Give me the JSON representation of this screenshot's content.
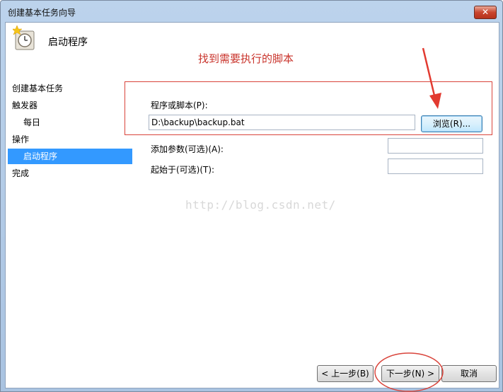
{
  "window": {
    "title": "创建基本任务向导",
    "close_label": "✕"
  },
  "header": {
    "title": "启动程序"
  },
  "annotation": {
    "text": "找到需要执行的脚本"
  },
  "sidebar": {
    "steps": [
      {
        "label": "创建基本任务"
      },
      {
        "label": "触发器"
      },
      {
        "label": "每日"
      },
      {
        "label": "操作"
      },
      {
        "label": "启动程序"
      },
      {
        "label": "完成"
      }
    ]
  },
  "form": {
    "program_label": "程序或脚本(P):",
    "program_value": "D:\\backup\\backup.bat",
    "browse_label": "浏览(R)...",
    "args_label": "添加参数(可选)(A):",
    "args_value": "",
    "startin_label": "起始于(可选)(T):",
    "startin_value": ""
  },
  "watermark": {
    "text": "http://blog.csdn.net/"
  },
  "footer": {
    "back_label": "< 上一步(B)",
    "next_label": "下一步(N) >",
    "cancel_label": "取消"
  },
  "colors": {
    "accent": "#3399ff",
    "annotation": "#d9443b"
  }
}
